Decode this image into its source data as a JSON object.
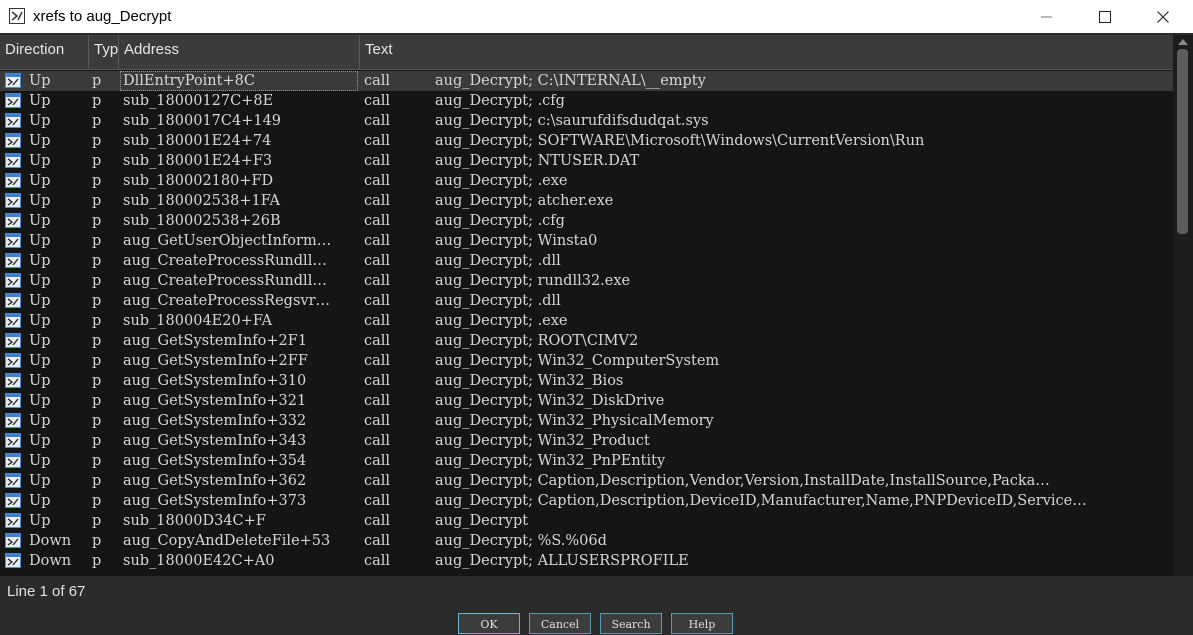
{
  "window": {
    "title": "xrefs to aug_Decrypt"
  },
  "columns": {
    "direction": "Direction",
    "type": "Typ",
    "address": "Address",
    "text": "Text"
  },
  "rows": [
    {
      "dir": "Up",
      "type": "p",
      "addr": "DllEntryPoint+8C",
      "ins": "call",
      "text": "aug_Decrypt; C:\\INTERNAL\\__empty"
    },
    {
      "dir": "Up",
      "type": "p",
      "addr": "sub_18000127C+8E",
      "ins": "call",
      "text": "aug_Decrypt; .cfg"
    },
    {
      "dir": "Up",
      "type": "p",
      "addr": "sub_1800017C4+149",
      "ins": "call",
      "text": "aug_Decrypt; c:\\saurufdifsdudqat.sys"
    },
    {
      "dir": "Up",
      "type": "p",
      "addr": "sub_180001E24+74",
      "ins": "call",
      "text": "aug_Decrypt; SOFTWARE\\Microsoft\\Windows\\CurrentVersion\\Run"
    },
    {
      "dir": "Up",
      "type": "p",
      "addr": "sub_180001E24+F3",
      "ins": "call",
      "text": "aug_Decrypt; NTUSER.DAT"
    },
    {
      "dir": "Up",
      "type": "p",
      "addr": "sub_180002180+FD",
      "ins": "call",
      "text": "aug_Decrypt; .exe"
    },
    {
      "dir": "Up",
      "type": "p",
      "addr": "sub_180002538+1FA",
      "ins": "call",
      "text": "aug_Decrypt; atcher.exe"
    },
    {
      "dir": "Up",
      "type": "p",
      "addr": "sub_180002538+26B",
      "ins": "call",
      "text": "aug_Decrypt; .cfg"
    },
    {
      "dir": "Up",
      "type": "p",
      "addr": "aug_GetUserObjectInform…",
      "ins": "call",
      "text": "aug_Decrypt; Winsta0"
    },
    {
      "dir": "Up",
      "type": "p",
      "addr": "aug_CreateProcessRundll…",
      "ins": "call",
      "text": "aug_Decrypt; .dll"
    },
    {
      "dir": "Up",
      "type": "p",
      "addr": "aug_CreateProcessRundll…",
      "ins": "call",
      "text": "aug_Decrypt; rundll32.exe"
    },
    {
      "dir": "Up",
      "type": "p",
      "addr": "aug_CreateProcessRegsvr…",
      "ins": "call",
      "text": "aug_Decrypt; .dll"
    },
    {
      "dir": "Up",
      "type": "p",
      "addr": "sub_180004E20+FA",
      "ins": "call",
      "text": "aug_Decrypt; .exe"
    },
    {
      "dir": "Up",
      "type": "p",
      "addr": "aug_GetSystemInfo+2F1",
      "ins": "call",
      "text": "aug_Decrypt; ROOT\\CIMV2"
    },
    {
      "dir": "Up",
      "type": "p",
      "addr": "aug_GetSystemInfo+2FF",
      "ins": "call",
      "text": "aug_Decrypt; Win32_ComputerSystem"
    },
    {
      "dir": "Up",
      "type": "p",
      "addr": "aug_GetSystemInfo+310",
      "ins": "call",
      "text": "aug_Decrypt; Win32_Bios"
    },
    {
      "dir": "Up",
      "type": "p",
      "addr": "aug_GetSystemInfo+321",
      "ins": "call",
      "text": "aug_Decrypt; Win32_DiskDrive"
    },
    {
      "dir": "Up",
      "type": "p",
      "addr": "aug_GetSystemInfo+332",
      "ins": "call",
      "text": "aug_Decrypt; Win32_PhysicalMemory"
    },
    {
      "dir": "Up",
      "type": "p",
      "addr": "aug_GetSystemInfo+343",
      "ins": "call",
      "text": "aug_Decrypt; Win32_Product"
    },
    {
      "dir": "Up",
      "type": "p",
      "addr": "aug_GetSystemInfo+354",
      "ins": "call",
      "text": "aug_Decrypt; Win32_PnPEntity"
    },
    {
      "dir": "Up",
      "type": "p",
      "addr": "aug_GetSystemInfo+362",
      "ins": "call",
      "text": "aug_Decrypt; Caption,Description,Vendor,Version,InstallDate,InstallSource,Packa…"
    },
    {
      "dir": "Up",
      "type": "p",
      "addr": "aug_GetSystemInfo+373",
      "ins": "call",
      "text": "aug_Decrypt; Caption,Description,DeviceID,Manufacturer,Name,PNPDeviceID,Service…"
    },
    {
      "dir": "Up",
      "type": "p",
      "addr": "sub_18000D34C+F",
      "ins": "call",
      "text": "aug_Decrypt"
    },
    {
      "dir": "Down",
      "type": "p",
      "addr": "aug_CopyAndDeleteFile+53",
      "ins": "call",
      "text": "aug_Decrypt; %S.%06d"
    },
    {
      "dir": "Down",
      "type": "p",
      "addr": "sub_18000E42C+A0",
      "ins": "call",
      "text": "aug_Decrypt; ALLUSERSPROFILE"
    }
  ],
  "status": "Line 1 of 67",
  "buttons": {
    "ok": "OK",
    "cancel": "Cancel",
    "search": "Search",
    "help": "Help"
  }
}
